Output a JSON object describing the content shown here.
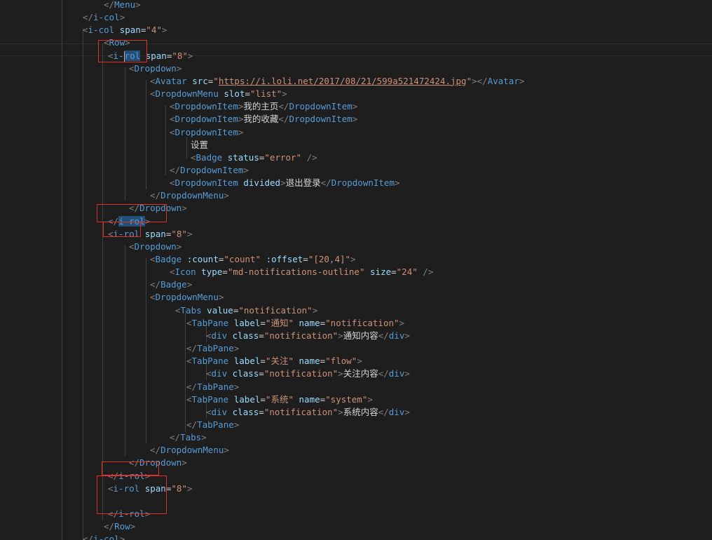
{
  "editor": {
    "colors": {
      "background": "#1e1e1e",
      "tag_bracket": "#808080",
      "tag_name": "#569cd6",
      "attr_name": "#9cdcfe",
      "attr_value": "#ce9178",
      "text": "#d4d4d4",
      "highlight_box": "#e0302a",
      "selection": "#264f78"
    },
    "lines": [
      [
        {
          "c": "tg",
          "t": "</"
        },
        {
          "c": "tn",
          "t": "Menu"
        },
        {
          "c": "tg",
          "t": ">"
        }
      ],
      [
        {
          "c": "tg",
          "t": "</"
        },
        {
          "c": "tn",
          "t": "i-col"
        },
        {
          "c": "tg",
          "t": ">"
        }
      ],
      [
        {
          "c": "tg",
          "t": "<"
        },
        {
          "c": "tn",
          "t": "i-col"
        },
        {
          "c": "txt",
          "t": " "
        },
        {
          "c": "an",
          "t": "span"
        },
        {
          "c": "txt",
          "t": "="
        },
        {
          "c": "av",
          "t": "\"4\""
        },
        {
          "c": "tg",
          "t": ">"
        }
      ],
      [
        {
          "c": "tg",
          "t": "<"
        },
        {
          "c": "tn",
          "t": "Row"
        },
        {
          "c": "tg",
          "t": ">"
        }
      ],
      [
        {
          "c": "tg",
          "t": "<"
        },
        {
          "c": "tn",
          "t": "i-"
        },
        {
          "c": "cursor",
          "t": ""
        },
        {
          "c": "tn sel-word",
          "t": "rol"
        },
        {
          "c": "txt",
          "t": " "
        },
        {
          "c": "an",
          "t": "span"
        },
        {
          "c": "txt",
          "t": "="
        },
        {
          "c": "av",
          "t": "\"8\""
        },
        {
          "c": "tg",
          "t": ">"
        }
      ],
      [
        {
          "c": "tg",
          "t": "<"
        },
        {
          "c": "tn",
          "t": "Dropdown"
        },
        {
          "c": "tg",
          "t": ">"
        }
      ],
      [
        {
          "c": "tg",
          "t": "<"
        },
        {
          "c": "tn",
          "t": "Avatar"
        },
        {
          "c": "txt",
          "t": " "
        },
        {
          "c": "an",
          "t": "src"
        },
        {
          "c": "txt",
          "t": "="
        },
        {
          "c": "av",
          "t": "\""
        },
        {
          "c": "avl",
          "t": "https://i.loli.net/2017/08/21/599a521472424.jpg"
        },
        {
          "c": "av",
          "t": "\""
        },
        {
          "c": "tg",
          "t": "></"
        },
        {
          "c": "tn",
          "t": "Avatar"
        },
        {
          "c": "tg",
          "t": ">"
        }
      ],
      [
        {
          "c": "tg",
          "t": "<"
        },
        {
          "c": "tn",
          "t": "DropdownMenu"
        },
        {
          "c": "txt",
          "t": " "
        },
        {
          "c": "an",
          "t": "slot"
        },
        {
          "c": "txt",
          "t": "="
        },
        {
          "c": "av",
          "t": "\"list\""
        },
        {
          "c": "tg",
          "t": ">"
        }
      ],
      [
        {
          "c": "tg",
          "t": "<"
        },
        {
          "c": "tn",
          "t": "DropdownItem"
        },
        {
          "c": "tg",
          "t": ">"
        },
        {
          "c": "tx",
          "t": "我的主页"
        },
        {
          "c": "tg",
          "t": "</"
        },
        {
          "c": "tn",
          "t": "DropdownItem"
        },
        {
          "c": "tg",
          "t": ">"
        }
      ],
      [
        {
          "c": "tg",
          "t": "<"
        },
        {
          "c": "tn",
          "t": "DropdownItem"
        },
        {
          "c": "tg",
          "t": ">"
        },
        {
          "c": "tx",
          "t": "我的收藏"
        },
        {
          "c": "tg",
          "t": "</"
        },
        {
          "c": "tn",
          "t": "DropdownItem"
        },
        {
          "c": "tg",
          "t": ">"
        }
      ],
      [
        {
          "c": "tg",
          "t": "<"
        },
        {
          "c": "tn",
          "t": "DropdownItem"
        },
        {
          "c": "tg",
          "t": ">"
        }
      ],
      [
        {
          "c": "tx",
          "t": "设置"
        }
      ],
      [
        {
          "c": "tg",
          "t": "<"
        },
        {
          "c": "tn",
          "t": "Badge"
        },
        {
          "c": "txt",
          "t": " "
        },
        {
          "c": "an",
          "t": "status"
        },
        {
          "c": "txt",
          "t": "="
        },
        {
          "c": "av",
          "t": "\"error\""
        },
        {
          "c": "txt",
          "t": " "
        },
        {
          "c": "tg",
          "t": "/>"
        }
      ],
      [
        {
          "c": "tg",
          "t": "</"
        },
        {
          "c": "tn",
          "t": "DropdownItem"
        },
        {
          "c": "tg",
          "t": ">"
        }
      ],
      [
        {
          "c": "tg",
          "t": "<"
        },
        {
          "c": "tn",
          "t": "DropdownItem"
        },
        {
          "c": "txt",
          "t": " "
        },
        {
          "c": "an",
          "t": "divided"
        },
        {
          "c": "tg",
          "t": ">"
        },
        {
          "c": "tx",
          "t": "退出登录"
        },
        {
          "c": "tg",
          "t": "</"
        },
        {
          "c": "tn",
          "t": "DropdownItem"
        },
        {
          "c": "tg",
          "t": ">"
        }
      ],
      [
        {
          "c": "tg",
          "t": "</"
        },
        {
          "c": "tn",
          "t": "DropdownMenu"
        },
        {
          "c": "tg",
          "t": ">"
        }
      ],
      [
        {
          "c": "tg",
          "t": "</"
        },
        {
          "c": "tn",
          "t": "Dropdown"
        },
        {
          "c": "tg",
          "t": ">"
        }
      ],
      [
        {
          "c": "tg",
          "t": "</"
        },
        {
          "c": "tn sel-word",
          "t": "i-rol"
        },
        {
          "c": "tg",
          "t": ">"
        }
      ],
      [
        {
          "c": "tg",
          "t": "<"
        },
        {
          "c": "tn",
          "t": "i-rol"
        },
        {
          "c": "txt",
          "t": " "
        },
        {
          "c": "an",
          "t": "span"
        },
        {
          "c": "txt",
          "t": "="
        },
        {
          "c": "av",
          "t": "\"8\""
        },
        {
          "c": "tg",
          "t": ">"
        }
      ],
      [
        {
          "c": "tg",
          "t": "<"
        },
        {
          "c": "tn",
          "t": "Dropdown"
        },
        {
          "c": "tg",
          "t": ">"
        }
      ],
      [
        {
          "c": "tg",
          "t": "<"
        },
        {
          "c": "tn",
          "t": "Badge"
        },
        {
          "c": "txt",
          "t": " "
        },
        {
          "c": "an",
          "t": ":count"
        },
        {
          "c": "txt",
          "t": "="
        },
        {
          "c": "av",
          "t": "\"count\""
        },
        {
          "c": "txt",
          "t": " "
        },
        {
          "c": "an",
          "t": ":offset"
        },
        {
          "c": "txt",
          "t": "="
        },
        {
          "c": "av",
          "t": "\"[20,4]\""
        },
        {
          "c": "tg",
          "t": ">"
        }
      ],
      [
        {
          "c": "tg",
          "t": "<"
        },
        {
          "c": "tn",
          "t": "Icon"
        },
        {
          "c": "txt",
          "t": " "
        },
        {
          "c": "an",
          "t": "type"
        },
        {
          "c": "txt",
          "t": "="
        },
        {
          "c": "av",
          "t": "\"md-notifications-outline\""
        },
        {
          "c": "txt",
          "t": " "
        },
        {
          "c": "an",
          "t": "size"
        },
        {
          "c": "txt",
          "t": "="
        },
        {
          "c": "av",
          "t": "\"24\""
        },
        {
          "c": "txt",
          "t": " "
        },
        {
          "c": "tg",
          "t": "/>"
        }
      ],
      [
        {
          "c": "tg",
          "t": "</"
        },
        {
          "c": "tn",
          "t": "Badge"
        },
        {
          "c": "tg",
          "t": ">"
        }
      ],
      [
        {
          "c": "tg",
          "t": "<"
        },
        {
          "c": "tn",
          "t": "DropdownMenu"
        },
        {
          "c": "tg",
          "t": ">"
        }
      ],
      [
        {
          "c": "tg",
          "t": "<"
        },
        {
          "c": "tn",
          "t": "Tabs"
        },
        {
          "c": "txt",
          "t": " "
        },
        {
          "c": "an",
          "t": "value"
        },
        {
          "c": "txt",
          "t": "="
        },
        {
          "c": "av",
          "t": "\"notification\""
        },
        {
          "c": "tg",
          "t": ">"
        }
      ],
      [
        {
          "c": "tg",
          "t": "<"
        },
        {
          "c": "tn",
          "t": "TabPane"
        },
        {
          "c": "txt",
          "t": " "
        },
        {
          "c": "an",
          "t": "label"
        },
        {
          "c": "txt",
          "t": "="
        },
        {
          "c": "av",
          "t": "\"通知\""
        },
        {
          "c": "txt",
          "t": " "
        },
        {
          "c": "an",
          "t": "name"
        },
        {
          "c": "txt",
          "t": "="
        },
        {
          "c": "av",
          "t": "\"notification\""
        },
        {
          "c": "tg",
          "t": ">"
        }
      ],
      [
        {
          "c": "tg",
          "t": "<"
        },
        {
          "c": "tn",
          "t": "div"
        },
        {
          "c": "txt",
          "t": " "
        },
        {
          "c": "an",
          "t": "class"
        },
        {
          "c": "txt",
          "t": "="
        },
        {
          "c": "av",
          "t": "\"notification\""
        },
        {
          "c": "tg",
          "t": ">"
        },
        {
          "c": "tx",
          "t": "通知内容"
        },
        {
          "c": "tg",
          "t": "</"
        },
        {
          "c": "tn",
          "t": "div"
        },
        {
          "c": "tg",
          "t": ">"
        }
      ],
      [
        {
          "c": "tg",
          "t": "</"
        },
        {
          "c": "tn",
          "t": "TabPane"
        },
        {
          "c": "tg",
          "t": ">"
        }
      ],
      [
        {
          "c": "tg",
          "t": "<"
        },
        {
          "c": "tn",
          "t": "TabPane"
        },
        {
          "c": "txt",
          "t": " "
        },
        {
          "c": "an",
          "t": "label"
        },
        {
          "c": "txt",
          "t": "="
        },
        {
          "c": "av",
          "t": "\"关注\""
        },
        {
          "c": "txt",
          "t": " "
        },
        {
          "c": "an",
          "t": "name"
        },
        {
          "c": "txt",
          "t": "="
        },
        {
          "c": "av",
          "t": "\"flow\""
        },
        {
          "c": "tg",
          "t": ">"
        }
      ],
      [
        {
          "c": "tg",
          "t": "<"
        },
        {
          "c": "tn",
          "t": "div"
        },
        {
          "c": "txt",
          "t": " "
        },
        {
          "c": "an",
          "t": "class"
        },
        {
          "c": "txt",
          "t": "="
        },
        {
          "c": "av",
          "t": "\"notification\""
        },
        {
          "c": "tg",
          "t": ">"
        },
        {
          "c": "tx",
          "t": "关注内容"
        },
        {
          "c": "tg",
          "t": "</"
        },
        {
          "c": "tn",
          "t": "div"
        },
        {
          "c": "tg",
          "t": ">"
        }
      ],
      [
        {
          "c": "tg",
          "t": "</"
        },
        {
          "c": "tn",
          "t": "TabPane"
        },
        {
          "c": "tg",
          "t": ">"
        }
      ],
      [
        {
          "c": "tg",
          "t": "<"
        },
        {
          "c": "tn",
          "t": "TabPane"
        },
        {
          "c": "txt",
          "t": " "
        },
        {
          "c": "an",
          "t": "label"
        },
        {
          "c": "txt",
          "t": "="
        },
        {
          "c": "av",
          "t": "\"系统\""
        },
        {
          "c": "txt",
          "t": " "
        },
        {
          "c": "an",
          "t": "name"
        },
        {
          "c": "txt",
          "t": "="
        },
        {
          "c": "av",
          "t": "\"system\""
        },
        {
          "c": "tg",
          "t": ">"
        }
      ],
      [
        {
          "c": "tg",
          "t": "<"
        },
        {
          "c": "tn",
          "t": "div"
        },
        {
          "c": "txt",
          "t": " "
        },
        {
          "c": "an",
          "t": "class"
        },
        {
          "c": "txt",
          "t": "="
        },
        {
          "c": "av",
          "t": "\"notification\""
        },
        {
          "c": "tg",
          "t": ">"
        },
        {
          "c": "tx",
          "t": "系统内容"
        },
        {
          "c": "tg",
          "t": "</"
        },
        {
          "c": "tn",
          "t": "div"
        },
        {
          "c": "tg",
          "t": ">"
        }
      ],
      [
        {
          "c": "tg",
          "t": "</"
        },
        {
          "c": "tn",
          "t": "TabPane"
        },
        {
          "c": "tg",
          "t": ">"
        }
      ],
      [
        {
          "c": "tg",
          "t": "</"
        },
        {
          "c": "tn",
          "t": "Tabs"
        },
        {
          "c": "tg",
          "t": ">"
        }
      ],
      [
        {
          "c": "tg",
          "t": "</"
        },
        {
          "c": "tn",
          "t": "DropdownMenu"
        },
        {
          "c": "tg",
          "t": ">"
        }
      ],
      [
        {
          "c": "tg",
          "t": "</"
        },
        {
          "c": "tn",
          "t": "Dropdown"
        },
        {
          "c": "tg",
          "t": ">"
        }
      ],
      [
        {
          "c": "tg",
          "t": "</"
        },
        {
          "c": "tn",
          "t": "i-rol"
        },
        {
          "c": "tg",
          "t": ">"
        }
      ],
      [
        {
          "c": "tg",
          "t": "<"
        },
        {
          "c": "tn",
          "t": "i-rol"
        },
        {
          "c": "txt",
          "t": " "
        },
        {
          "c": "an",
          "t": "span"
        },
        {
          "c": "txt",
          "t": "="
        },
        {
          "c": "av",
          "t": "\"8\""
        },
        {
          "c": "tg",
          "t": ">"
        }
      ],
      [],
      [
        {
          "c": "tg",
          "t": "</"
        },
        {
          "c": "tn",
          "t": "i-rol"
        },
        {
          "c": "tg",
          "t": ">"
        }
      ],
      [
        {
          "c": "tg",
          "t": "</"
        },
        {
          "c": "tn",
          "t": "Row"
        },
        {
          "c": "tg",
          "t": ">"
        }
      ],
      [
        {
          "c": "tg",
          "t": "</"
        },
        {
          "c": "tn",
          "t": "i-col"
        },
        {
          "c": "tg",
          "t": ">"
        }
      ]
    ]
  }
}
